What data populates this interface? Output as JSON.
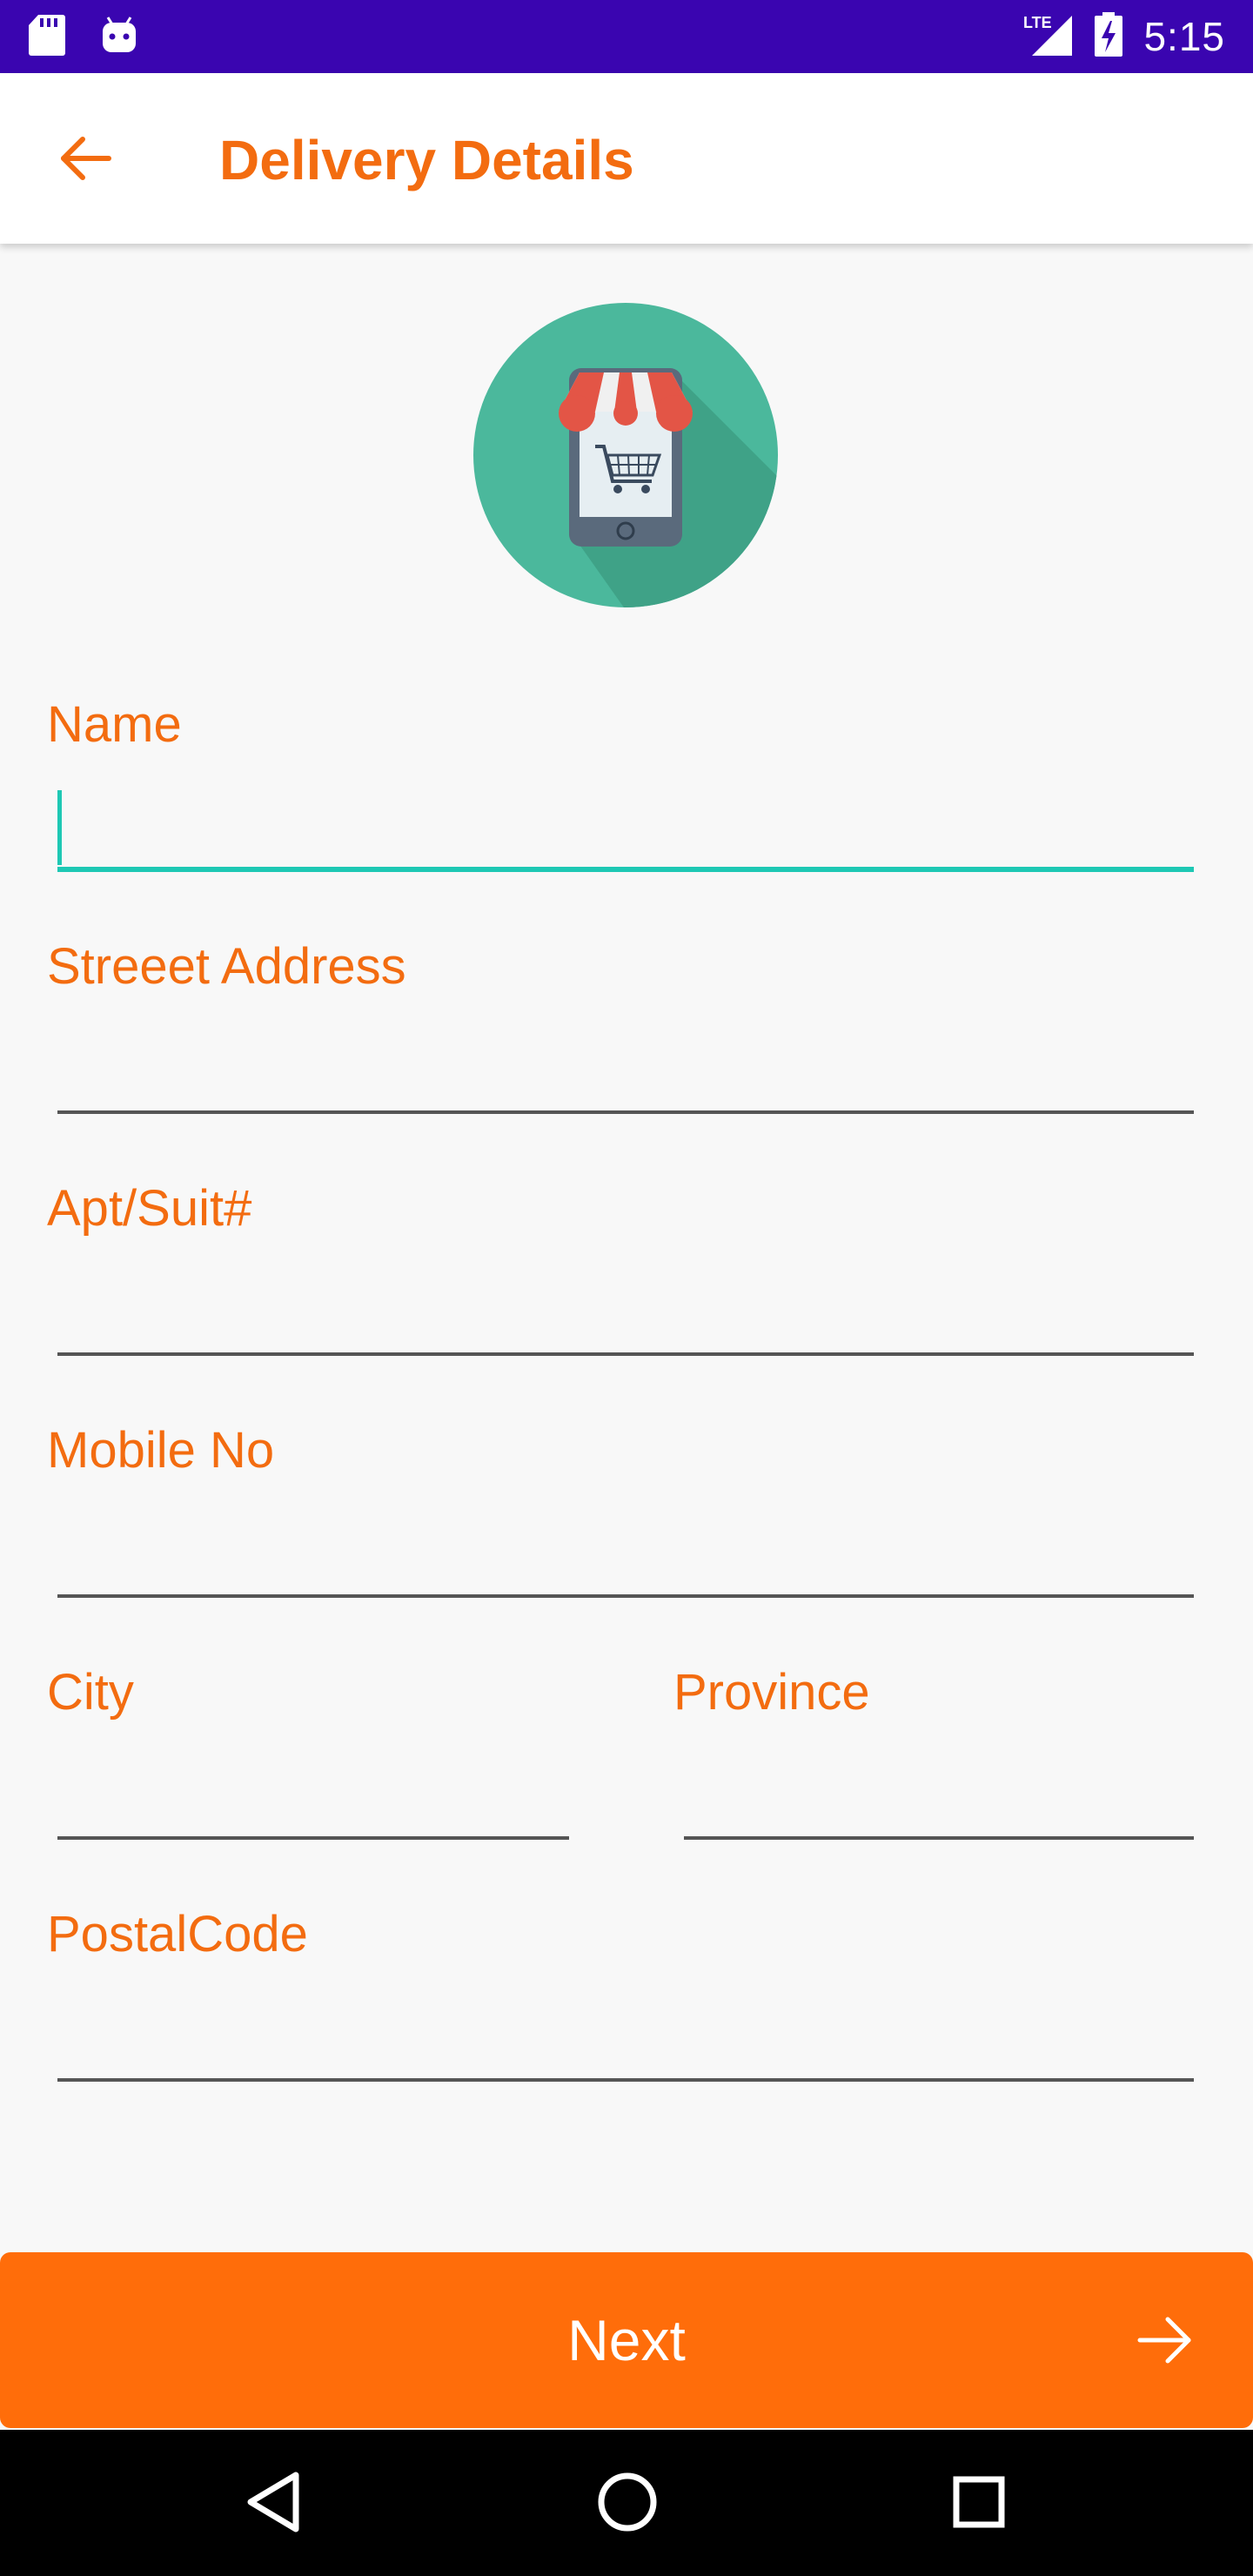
{
  "status_bar": {
    "time": "5:15",
    "network_label": "LTE",
    "icons": [
      "sd-card-icon",
      "android-icon",
      "signal-icon",
      "battery-icon"
    ],
    "background": "#3a05b0"
  },
  "app_bar": {
    "title": "Delivery Details",
    "back_icon": "arrow-left-icon",
    "accent": "#f36c10"
  },
  "logo": {
    "icon": "mobile-shop-cart-icon",
    "circle_color": "#4bb89c"
  },
  "form": {
    "name": {
      "label": "Name",
      "value": "",
      "focused": true
    },
    "street": {
      "label": "Streeet Address",
      "value": ""
    },
    "apt": {
      "label": "Apt/Suit#",
      "value": ""
    },
    "mobile": {
      "label": "Mobile No",
      "value": ""
    },
    "city": {
      "label": "City",
      "value": ""
    },
    "province": {
      "label": "Province",
      "value": ""
    },
    "postal": {
      "label": "PostalCode",
      "value": ""
    },
    "focus_color": "#1ec8b4"
  },
  "next_button": {
    "label": "Next",
    "icon": "arrow-right-icon",
    "color": "#ff6d0a"
  },
  "nav_bar": {
    "icons": [
      "back-triangle-icon",
      "home-circle-icon",
      "recents-square-icon"
    ]
  }
}
